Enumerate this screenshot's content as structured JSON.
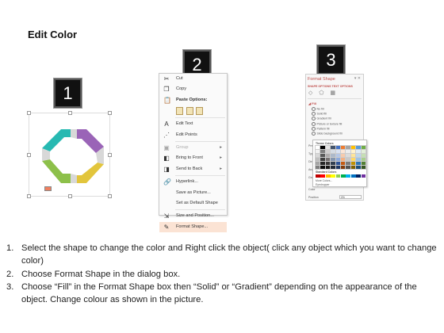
{
  "page": {
    "title": "Edit Color"
  },
  "badges": [
    "1",
    "2",
    "3"
  ],
  "octagon_colors": {
    "teal": "#27b9b2",
    "purple": "#9a64b7",
    "yellow": "#e2c53c",
    "green": "#8dc04a",
    "shadow": "#d8d8d8"
  },
  "context_menu": {
    "items": [
      {
        "label": "Cut",
        "icon": "scissors-icon",
        "glyph": "✂",
        "disabled": false
      },
      {
        "label": "Copy",
        "icon": "copy-icon",
        "glyph": "❐",
        "disabled": false
      },
      {
        "label": "Paste Options:",
        "icon": "paste-icon",
        "glyph": "📋",
        "disabled": false,
        "bold": true
      }
    ],
    "items2": [
      {
        "label": "Edit Text",
        "icon": "edit-text-icon",
        "glyph": "A",
        "disabled": false
      },
      {
        "label": "Edit Points",
        "icon": "edit-points-icon",
        "glyph": "⋰",
        "disabled": false
      },
      {
        "label": "Group",
        "icon": "group-icon",
        "glyph": "▣",
        "disabled": true,
        "submenu": true
      },
      {
        "label": "Bring to Front",
        "icon": "bring-front-icon",
        "glyph": "◧",
        "disabled": false,
        "submenu": true
      },
      {
        "label": "Send to Back",
        "icon": "send-back-icon",
        "glyph": "◨",
        "disabled": false,
        "submenu": true
      },
      {
        "label": "Hyperlink...",
        "icon": "hyperlink-icon",
        "glyph": "🔗",
        "disabled": false
      },
      {
        "label": "Save as Picture...",
        "icon": "",
        "glyph": "",
        "disabled": false
      },
      {
        "label": "Set as Default Shape",
        "icon": "",
        "glyph": "",
        "disabled": false
      },
      {
        "label": "Size and Position...",
        "icon": "size-position-icon",
        "glyph": "⇲",
        "disabled": false
      },
      {
        "label": "Format Shape...",
        "icon": "format-shape-icon",
        "glyph": "✎",
        "disabled": false,
        "highlight": true
      }
    ],
    "arrow": "▸"
  },
  "format_pane": {
    "title": "Format Shape",
    "close": "▾ ✕",
    "subtitle": "SHAPE OPTIONS   TEXT OPTIONS",
    "tabs": "◇ ⬠ ▦",
    "section_fill": "◢ Fill",
    "fill_options": [
      "No fill",
      "Solid fill",
      "Gradient fill",
      "Picture or texture fill",
      "Pattern fill",
      "Slide background fill"
    ],
    "labels": [
      "Preset gr...",
      "Type",
      "Direction",
      "Angle",
      "Gradient"
    ],
    "color_label": "Color",
    "position_label": "Position",
    "position_value": "0%",
    "palette_theme": "Theme Colors",
    "palette_standard": "Standard Colors",
    "palette_more": [
      "More Colors...",
      "Eyedropper"
    ]
  },
  "palette_colors": {
    "theme": [
      [
        "#ffffff",
        "#000000",
        "#e7e6e6",
        "#44546a",
        "#4472c4",
        "#ed7d31",
        "#a5a5a5",
        "#ffc000",
        "#5b9bd5",
        "#70ad47"
      ],
      [
        "#f2f2f2",
        "#7f7f7f",
        "#d0cece",
        "#d6dce4",
        "#d9e2f3",
        "#fbe5d5",
        "#ededed",
        "#fff2cc",
        "#deebf6",
        "#e2efd9"
      ],
      [
        "#d8d8d8",
        "#595959",
        "#aeabab",
        "#adb9ca",
        "#b4c6e7",
        "#f7cbac",
        "#dbdbdb",
        "#fee599",
        "#bdd7ee",
        "#c5e0b3"
      ],
      [
        "#bfbfbf",
        "#3f3f3f",
        "#757070",
        "#8496b0",
        "#8eaadb",
        "#f4b183",
        "#c9c9c9",
        "#ffd965",
        "#9dc3e6",
        "#a8d08d"
      ],
      [
        "#a5a5a5",
        "#262626",
        "#3a3838",
        "#323f4f",
        "#2f5496",
        "#c55a11",
        "#7b7b7b",
        "#bf9000",
        "#2e75b5",
        "#538135"
      ],
      [
        "#7f7f7f",
        "#0c0c0c",
        "#171616",
        "#222a35",
        "#1f3864",
        "#833c0b",
        "#525252",
        "#7f6000",
        "#1e4e79",
        "#375623"
      ]
    ],
    "standard": [
      "#c00000",
      "#ff0000",
      "#ffc000",
      "#ffff00",
      "#92d050",
      "#00b050",
      "#00b0f0",
      "#0070c0",
      "#002060",
      "#7030a0"
    ]
  },
  "instructions": [
    {
      "num": "1.",
      "text": "Select the shape to change the color and Right click the object( click any object which you want to change color)"
    },
    {
      "num": "2.",
      "text": "Choose Format Shape in the dialog box."
    },
    {
      "num": "3.",
      "text": "Choose “Fill” in the Format Shape box then “Solid” or “Gradient” depending on the appearance of the object. Change colour as shown in the picture."
    }
  ]
}
